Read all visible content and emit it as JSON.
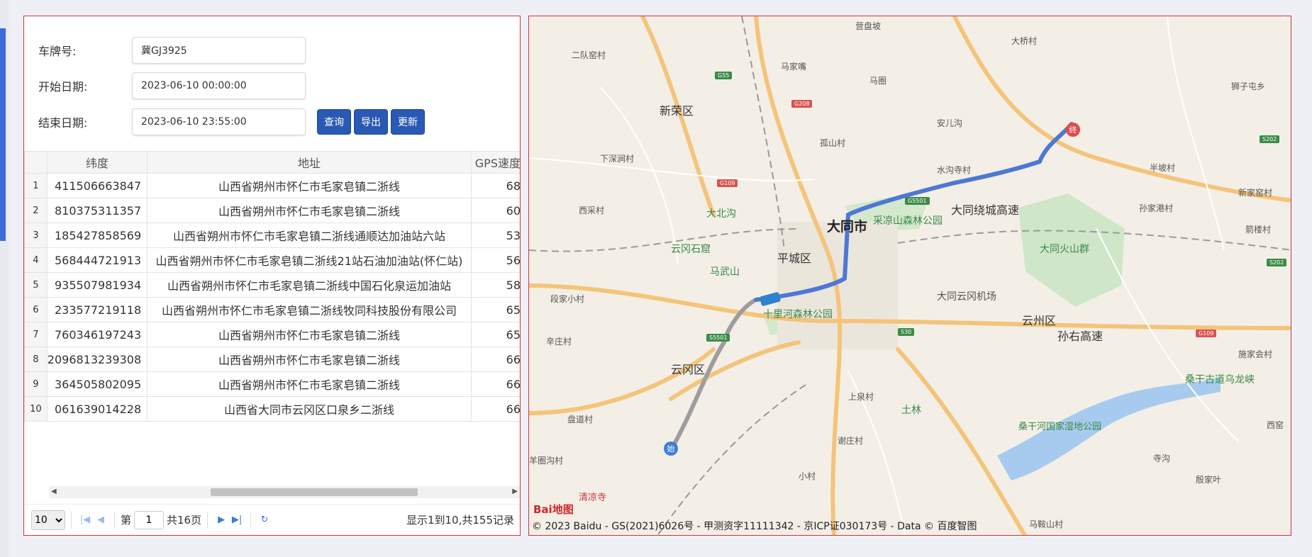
{
  "form": {
    "plate_label": "车牌号:",
    "plate_value": "冀GJ3925",
    "start_label": "开始日期:",
    "start_value": "2023-06-10 00:00:00",
    "end_label": "结束日期:",
    "end_value": "2023-06-10 23:55:00",
    "query_label": "查询",
    "export_label": "导出",
    "refresh_label": "更新"
  },
  "table": {
    "headers": [
      "纬度",
      "地址",
      "GPS速度"
    ],
    "rows": [
      {
        "n": "1",
        "lat": "411506663847",
        "addr": "山西省朔州市怀仁市毛家皂镇二浙线",
        "spd": "68"
      },
      {
        "n": "2",
        "lat": "810375311357",
        "addr": "山西省朔州市怀仁市毛家皂镇二浙线",
        "spd": "60"
      },
      {
        "n": "3",
        "lat": "185427858569",
        "addr": "山西省朔州市怀仁市毛家皂镇二浙线通顺达加油站六站",
        "spd": "53"
      },
      {
        "n": "4",
        "lat": "568444721913",
        "addr": "山西省朔州市怀仁市毛家皂镇二浙线21站石油加油站(怀仁站)",
        "spd": "56"
      },
      {
        "n": "5",
        "lat": "935507981934",
        "addr": "山西省朔州市怀仁市毛家皂镇二浙线中国石化泉运加油站",
        "spd": "58"
      },
      {
        "n": "6",
        "lat": "233577219118",
        "addr": "山西省朔州市怀仁市毛家皂镇二浙线牧同科技股份有限公司",
        "spd": "65"
      },
      {
        "n": "7",
        "lat": "760346197243",
        "addr": "山西省朔州市怀仁市毛家皂镇二浙线",
        "spd": "65"
      },
      {
        "n": "8",
        "lat": "2096813239308",
        "addr": "山西省朔州市怀仁市毛家皂镇二浙线",
        "spd": "66"
      },
      {
        "n": "9",
        "lat": "364505802095",
        "addr": "山西省朔州市怀仁市毛家皂镇二浙线",
        "spd": "66"
      },
      {
        "n": "10",
        "lat": "061639014228",
        "addr": "山西省大同市云冈区口泉乡二浙线",
        "spd": "66"
      }
    ]
  },
  "pager": {
    "page_size": "10",
    "page_prefix": "第",
    "page_value": "1",
    "page_suffix": "共16页",
    "info": "显示1到10,共155记录"
  },
  "map": {
    "labels": {
      "l1": "大同市",
      "l2": "平城区",
      "l3": "云冈区",
      "l4": "云州区",
      "l5": "新荣区",
      "l6": "孙右高速",
      "l7": "大同绕城高速",
      "l8": "大同云冈机场",
      "l9": "大同火山群",
      "l10": "采凉山森林公园",
      "l11": "大北沟",
      "l12": "云冈石窟",
      "l13": "马武山",
      "l14": "十里河森林公园",
      "l15": "桑干河国家湿地公园",
      "l16": "桑干古道乌龙峡",
      "l17": "土林",
      "l18": "清凉寺",
      "l19": "二队窑村",
      "l20": "马家嘴",
      "l21": "马圈",
      "l22": "安儿沟",
      "l23": "孤山村",
      "l24": "水沟寺村",
      "l25": "大桥村",
      "l26": "下深涧村",
      "l27": "西采村",
      "l28": "段家小村",
      "l29": "辛庄村",
      "l30": "盘道村",
      "l31": "羊圈沟村",
      "l32": "上泉村",
      "l33": "谢庄村",
      "l34": "小村",
      "l35": "寺沟",
      "l36": "西窑",
      "l37": "施家会村",
      "l38": "箭楼村",
      "l39": "新家窑村",
      "l40": "孙家港村",
      "l41": "半坡村",
      "l42": "狮子屯乡",
      "l43": "马鞍山村",
      "l44": "殷家叶",
      "l45": "营盘坡"
    },
    "start_marker": "始",
    "end_marker": "终",
    "logo": "Bai地图",
    "copyright": "© 2023 Baidu - GS(2021)6026号 - 甲测资字11111342 - 京ICP证030173号 - Data © 百度智图",
    "route_color": "#4e77d6",
    "colors": {
      "border": "#c8393c",
      "button": "#2a59b3"
    }
  }
}
